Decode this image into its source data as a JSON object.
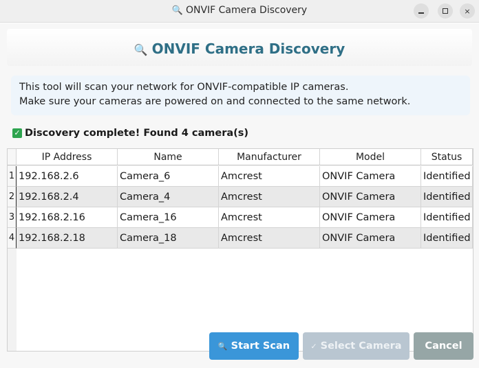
{
  "window": {
    "title_icon": "🔍",
    "title": "ONVIF Camera Discovery",
    "controls": {
      "minimize": "minimize-icon",
      "maximize": "maximize-icon",
      "close": "×"
    }
  },
  "header": {
    "icon": "🔍",
    "title": "ONVIF Camera Discovery"
  },
  "info": {
    "line1": "This tool will scan your network for ONVIF-compatible IP cameras.",
    "line2": "Make sure your cameras are powered on and connected to the same network."
  },
  "status": {
    "icon": "✓",
    "text": "Discovery complete! Found 4 camera(s)"
  },
  "table": {
    "columns": [
      "IP Address",
      "Name",
      "Manufacturer",
      "Model",
      "Status"
    ],
    "rows": [
      {
        "num": "1",
        "cells": [
          "192.168.2.6",
          "Camera_6",
          "Amcrest",
          "ONVIF Camera",
          "Identified"
        ]
      },
      {
        "num": "2",
        "cells": [
          "192.168.2.4",
          "Camera_4",
          "Amcrest",
          "ONVIF Camera",
          "Identified"
        ]
      },
      {
        "num": "3",
        "cells": [
          "192.168.2.16",
          "Camera_16",
          "Amcrest",
          "ONVIF Camera",
          "Identified"
        ]
      },
      {
        "num": "4",
        "cells": [
          "192.168.2.18",
          "Camera_18",
          "Amcrest",
          "ONVIF Camera",
          "Identified"
        ]
      }
    ]
  },
  "buttons": {
    "scan_icon": "🔍",
    "scan_label": "Start Scan",
    "select_icon": "✓",
    "select_label": "Select Camera",
    "cancel_label": "Cancel"
  },
  "colors": {
    "header_title": "#2f6f86",
    "info_bg": "#eef5fb",
    "scan_button": "#3a96d9",
    "select_button_disabled": "#b9c6d1",
    "cancel_button": "#96a6a6",
    "alt_row": "#e9e9e9"
  }
}
